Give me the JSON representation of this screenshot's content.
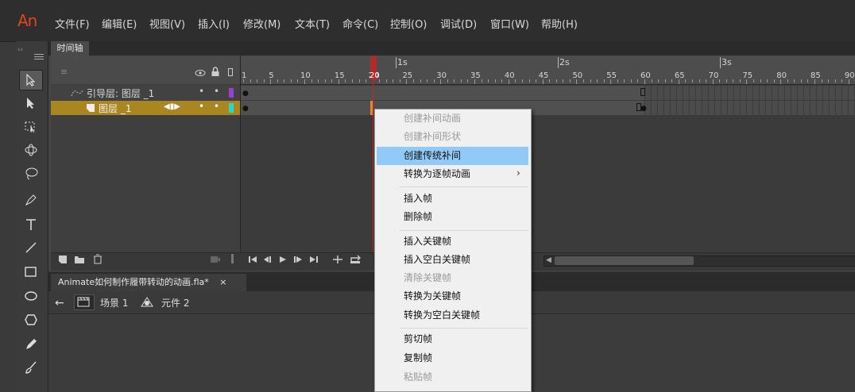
{
  "app": {
    "logo": "An"
  },
  "menu": [
    "文件(F)",
    "编辑(E)",
    "视图(V)",
    "插入(I)",
    "修改(M)",
    "文本(T)",
    "命令(C)",
    "控制(O)",
    "调试(D)",
    "窗口(W)",
    "帮助(H)"
  ],
  "timeline": {
    "tab": "时间轴",
    "header_glyph": "≡",
    "layers": [
      {
        "name": "引导层: 图层 _1",
        "type": "guide"
      },
      {
        "name": "图层 _1",
        "type": "normal",
        "selected": true
      }
    ],
    "ruler_frames": [
      "1",
      "5",
      "10",
      "15",
      "20",
      "25",
      "30",
      "35",
      "40",
      "45",
      "50",
      "55",
      "60",
      "65",
      "70",
      "75",
      "80",
      "85",
      "90"
    ],
    "ruler_seconds": [
      "1s",
      "2s",
      "3s"
    ],
    "current_frame": 20
  },
  "document": {
    "tab_title": "Animate如何制作履带转动的动画.fla*",
    "close_glyph": "×",
    "breadcrumb": [
      {
        "label": "场景 1"
      },
      {
        "label": "元件 2"
      }
    ]
  },
  "context_menu": {
    "items": [
      {
        "label": "创建补间动画",
        "enabled": false
      },
      {
        "label": "创建补间形状",
        "enabled": false
      },
      {
        "label": "创建传统补间",
        "enabled": true,
        "highlighted": true
      },
      {
        "label": "转换为逐帧动画",
        "enabled": true,
        "submenu": true
      },
      {
        "label": "插入帧",
        "enabled": true
      },
      {
        "label": "删除帧",
        "enabled": true
      },
      {
        "label": "插入关键帧",
        "enabled": true
      },
      {
        "label": "插入空白关键帧",
        "enabled": true
      },
      {
        "label": "清除关键帧",
        "enabled": false
      },
      {
        "label": "转换为关键帧",
        "enabled": true
      },
      {
        "label": "转换为空白关键帧",
        "enabled": true
      },
      {
        "label": "剪切帧",
        "enabled": true
      },
      {
        "label": "复制帧",
        "enabled": true
      },
      {
        "label": "粘贴帧",
        "enabled": false
      }
    ]
  },
  "colors": {
    "accent_logo": "#e0441b",
    "selected_layer": "#a9861f",
    "playhead": "#cc2222",
    "menu_highlight": "#91c9f7",
    "guide_layer_swatch": "#9b3fd0",
    "layer_swatch": "#2fd6c8"
  }
}
